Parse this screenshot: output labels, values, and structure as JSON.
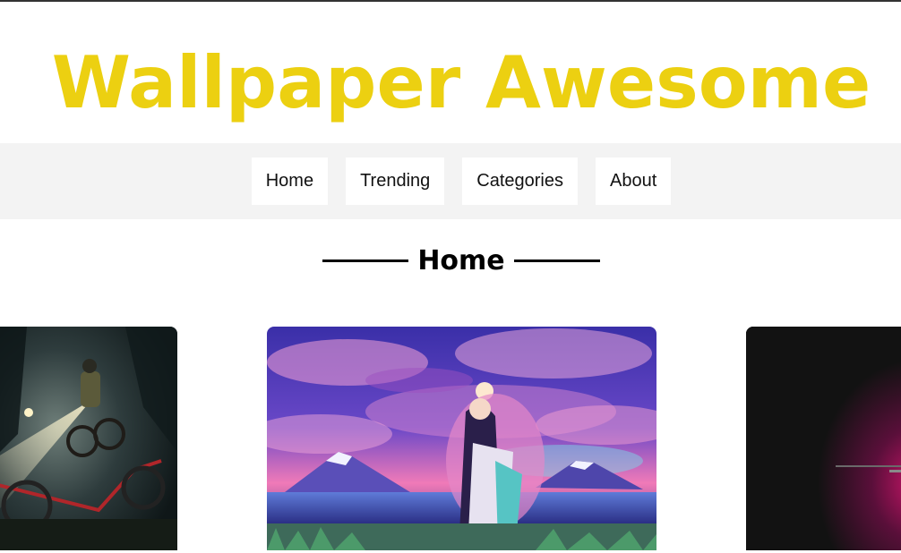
{
  "site": {
    "title": "Wallpaper Awesome",
    "brand_color": "#ecd011"
  },
  "nav": {
    "items": [
      {
        "label": "Home"
      },
      {
        "label": "Trending"
      },
      {
        "label": "Categories"
      },
      {
        "label": "About"
      }
    ]
  },
  "main": {
    "section_title": "Home",
    "cards": [
      {
        "image": "night-forest-bikes-wallpaper"
      },
      {
        "image": "anime-sakura-mountain-wallpaper"
      },
      {
        "image": "dark-gradient-wallpaper"
      }
    ]
  }
}
